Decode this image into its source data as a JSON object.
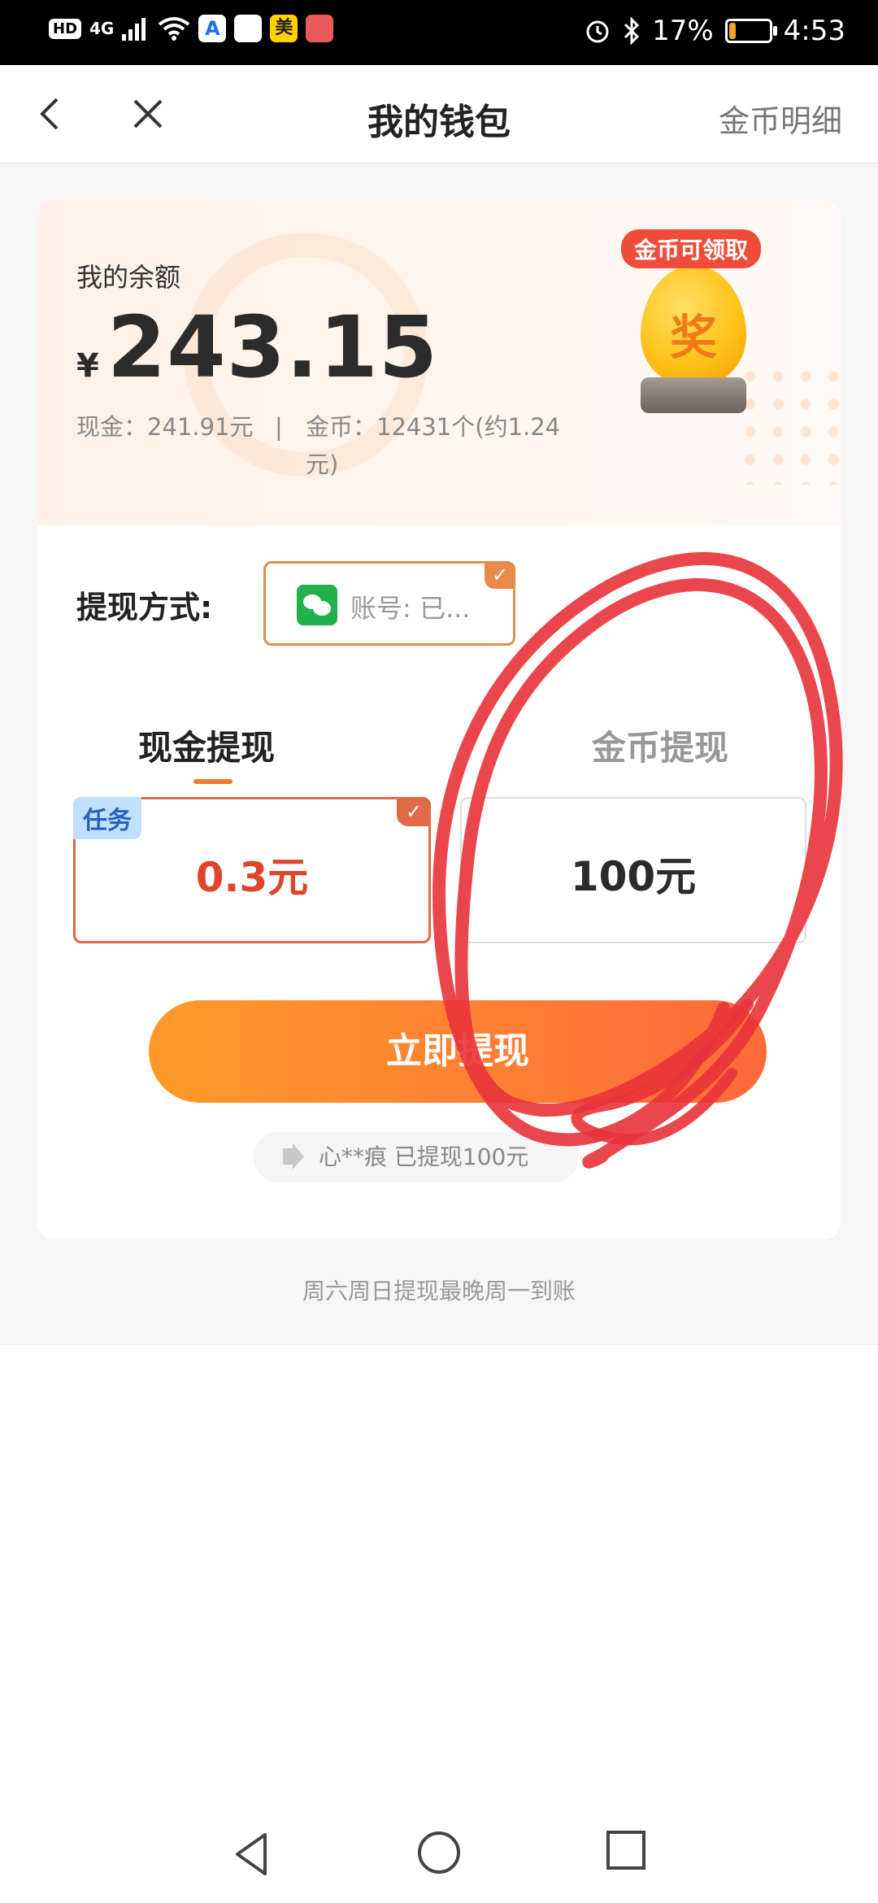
{
  "status_bar": {
    "left_badges": [
      "HD",
      "4G"
    ],
    "app_icon_a": "A",
    "app_icon_m": "美",
    "battery_percent": "17%",
    "battery_level": 0.17,
    "time": "4:53"
  },
  "nav": {
    "title": "我的钱包",
    "right_link": "金币明细"
  },
  "balance": {
    "label": "我的余额",
    "currency": "¥",
    "amount": "243.15",
    "cash": "现金：241.91元",
    "separator": "|",
    "coins": "金币：12431个(约1.24元)"
  },
  "promo": {
    "tag": "金币可领取",
    "egg_text": "奖"
  },
  "withdraw_method": {
    "label": "提现方式:",
    "account": "账号: 已...",
    "check": "✓"
  },
  "tabs": {
    "cash": "现金提现",
    "coin": "金币提现"
  },
  "options": [
    {
      "tag": "任务",
      "value": "0.3元",
      "selected": true,
      "check": "✓"
    },
    {
      "value": "100元",
      "selected": false
    }
  ],
  "submit_label": "立即提现",
  "notice": "心**痕 已提现100元",
  "footnote": "周六周日提现最晚周一到账",
  "colors": {
    "accent": "#ff7a2a",
    "selected_value": "#e0442a",
    "tag_bg": "#bfe0ff",
    "annotation_red": "#e8333a"
  }
}
